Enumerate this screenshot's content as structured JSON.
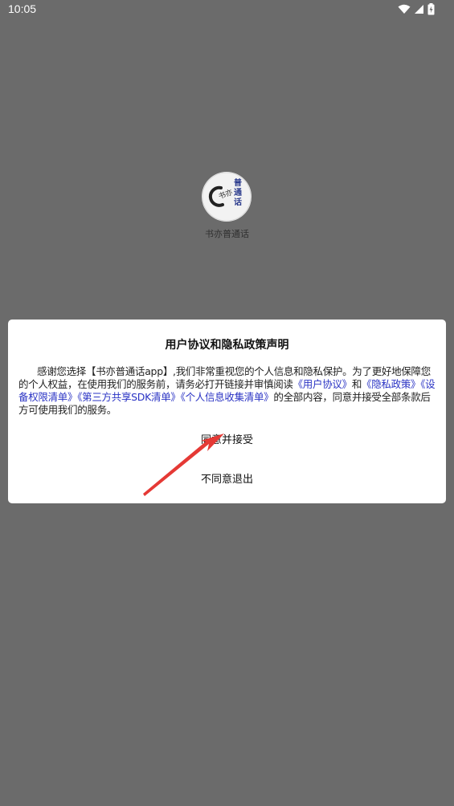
{
  "status_bar": {
    "time": "10:05",
    "icons": [
      "wifi-icon",
      "signal-icon",
      "battery-icon"
    ]
  },
  "splash": {
    "logo_icon": "app-logo-icon",
    "logo_text": "普通话",
    "app_name": "书亦普通话"
  },
  "dialog": {
    "title": "用户协议和隐私政策声明",
    "body": {
      "part1": "感谢您选择【书亦普通话app】,我们非常重视您的个人信息和隐私保护。为了更好地保障您的个人权益，在使用我们的服务前，请务必打开链接并审慎阅读",
      "link_user_agreement": "《用户协议》",
      "and": "和",
      "link_privacy_policy": "《隐私政策》",
      "link_device_permissions": "《设备权限清单》",
      "link_third_party_sdk": "《第三方共享SDK清单》",
      "link_personal_info": "《个人信息收集清单》",
      "part2": "的全部内容，同意并接受全部条款后方可使用我们的服务。"
    },
    "agree_label": "同意并接受",
    "disagree_label": "不同意退出"
  },
  "colors": {
    "overlay": "#6b6b6b",
    "link": "#2a33c4",
    "annotation_arrow": "#e53935"
  }
}
